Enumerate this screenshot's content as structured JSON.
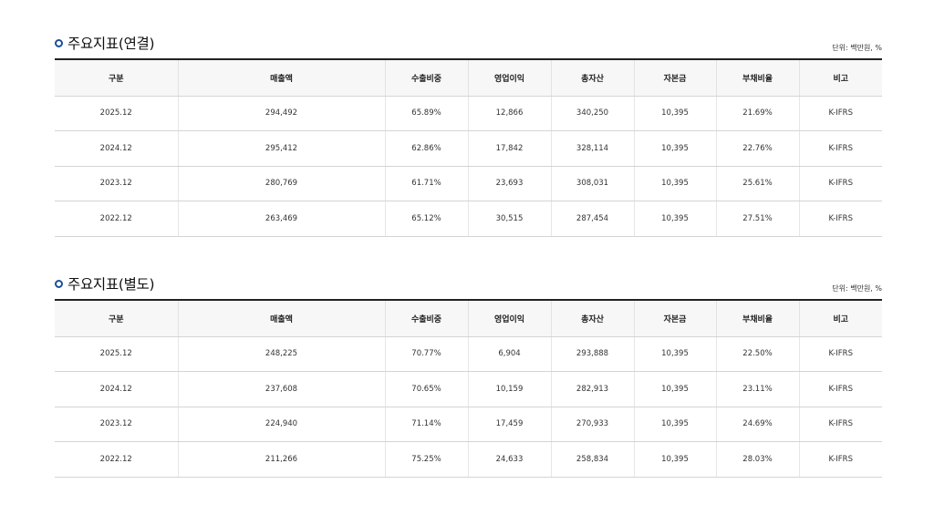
{
  "unit_label": "단위: 백만원, %",
  "columns": [
    "구분",
    "매출액",
    "수출비중",
    "영업이익",
    "총자산",
    "자본금",
    "부채비율",
    "비고"
  ],
  "sections": [
    {
      "title": "주요지표(연결)",
      "rows": [
        [
          "2025.12",
          "294,492",
          "65.89%",
          "12,866",
          "340,250",
          "10,395",
          "21.69%",
          "K-IFRS"
        ],
        [
          "2024.12",
          "295,412",
          "62.86%",
          "17,842",
          "328,114",
          "10,395",
          "22.76%",
          "K-IFRS"
        ],
        [
          "2023.12",
          "280,769",
          "61.71%",
          "23,693",
          "308,031",
          "10,395",
          "25.61%",
          "K-IFRS"
        ],
        [
          "2022.12",
          "263,469",
          "65.12%",
          "30,515",
          "287,454",
          "10,395",
          "27.51%",
          "K-IFRS"
        ]
      ]
    },
    {
      "title": "주요지표(별도)",
      "rows": [
        [
          "2025.12",
          "248,225",
          "70.77%",
          "6,904",
          "293,888",
          "10,395",
          "22.50%",
          "K-IFRS"
        ],
        [
          "2024.12",
          "237,608",
          "70.65%",
          "10,159",
          "282,913",
          "10,395",
          "23.11%",
          "K-IFRS"
        ],
        [
          "2023.12",
          "224,940",
          "71.14%",
          "17,459",
          "270,933",
          "10,395",
          "24.69%",
          "K-IFRS"
        ],
        [
          "2022.12",
          "211,266",
          "75.25%",
          "24,633",
          "258,834",
          "10,395",
          "28.03%",
          "K-IFRS"
        ]
      ]
    }
  ]
}
